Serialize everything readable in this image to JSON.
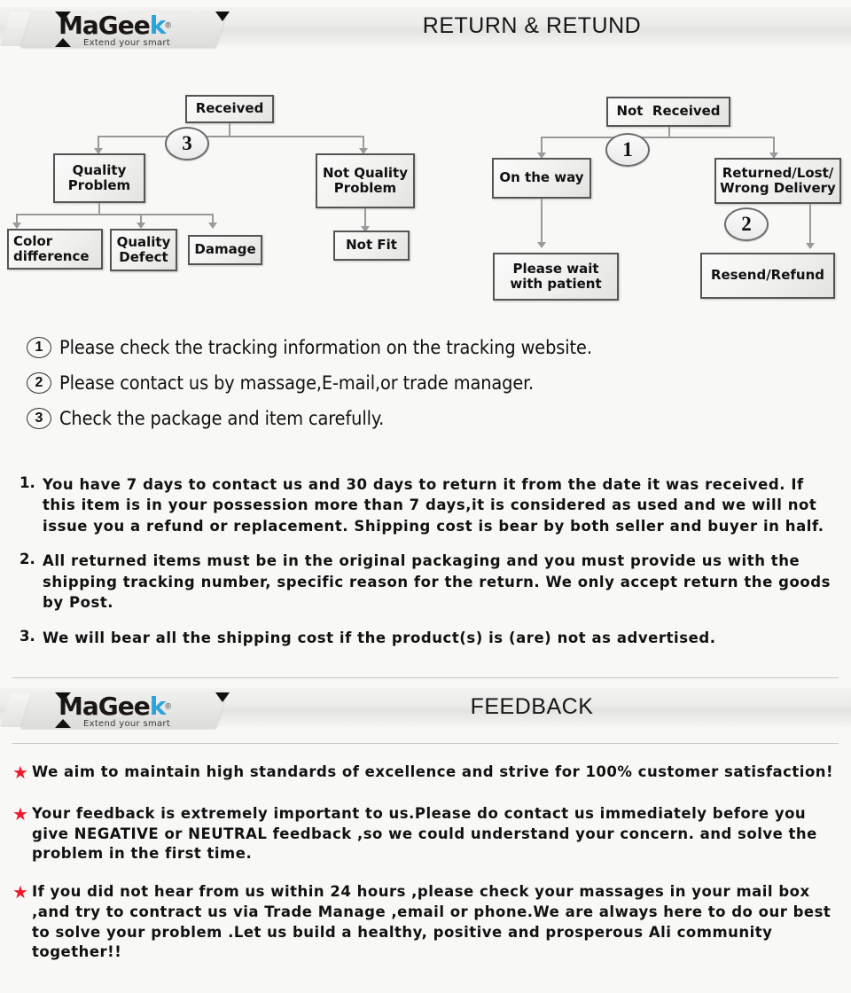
{
  "brand": {
    "name_part1": "MaGee",
    "name_k": "k",
    "registered": "®",
    "tagline": "Extend your smart"
  },
  "banners": [
    {
      "title": "RETURN & RETUND"
    },
    {
      "title": "FEEDBACK"
    }
  ],
  "flowchart": {
    "left": {
      "root": "Received",
      "marker": "3",
      "branch_quality": "Quality\nProblem",
      "branch_not_quality": "Not Quality\nProblem",
      "leaf_color": "Color\ndifference",
      "leaf_defect": "Quality\nDefect",
      "leaf_damage": "Damage",
      "leaf_notfit": "Not Fit"
    },
    "right": {
      "root": "Not  Received",
      "marker_1": "1",
      "marker_2": "2",
      "branch_onway": "On the way",
      "branch_returned": "Returned/Lost/\nWrong Delivery",
      "leaf_wait": "Please wait\nwith patient",
      "leaf_resend": "Resend/Refund"
    }
  },
  "instructions": [
    {
      "num": "1",
      "text": "Please check the tracking information on the tracking website."
    },
    {
      "num": "2",
      "text": "Please contact us by  massage,E-mail,or trade manager."
    },
    {
      "num": "3",
      "text": "Check the package and item carefully."
    }
  ],
  "policies": [
    {
      "num": "1.",
      "text": "You have 7 days to contact us and 30 days to return it from the date it was received. If this item is in your possession more than 7 days,it is considered as used and we will not issue you a refund or replacement. Shipping cost is bear by both seller and buyer in half."
    },
    {
      "num": "2.",
      "text": "All returned items must be in the original packaging and you must provide us with the shipping tracking number, specific reason for the return. We only accept return the goods by Post."
    },
    {
      "num": "3.",
      "text": "We will bear all the shipping cost if the product(s) is (are) not as advertised."
    }
  ],
  "feedback": [
    {
      "bullet": "★",
      "text": "We aim to maintain high standards of excellence and strive  for 100% customer satisfaction!"
    },
    {
      "bullet": "★",
      "text": "Your feedback is extremely important to us.Please do contact us immediately before you give NEGATIVE or NEUTRAL feedback ,so  we could understand your concern. and solve the problem in the first time."
    },
    {
      "bullet": "★",
      "text": "If you did not hear from us within 24 hours ,please check your massages in your mail box ,and try to contract us via Trade Manage ,email or phone.We are always here to do our best to solve your problem .Let us build a healthy, positive and prosperous Ali community together!!"
    }
  ],
  "colors": {
    "star_red": "#ee1b2e",
    "logo_accent": "#2ba3dd",
    "background": "#f8f8f6"
  }
}
